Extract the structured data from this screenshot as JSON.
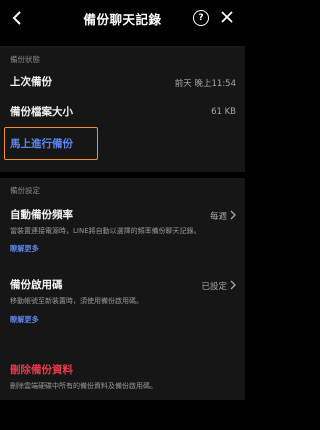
{
  "header": {
    "title": "備份聊天記錄",
    "help_glyph": "?"
  },
  "status_section": {
    "label": "備份狀態",
    "last_backup": {
      "label": "上次備份",
      "value": "前天 晚上11:54"
    },
    "file_size": {
      "label": "備份檔案大小",
      "value": "61 KB"
    },
    "backup_now": "馬上進行備份"
  },
  "settings_section": {
    "label": "備份設定",
    "auto_freq": {
      "label": "自動備份頻率",
      "value": "每週",
      "desc": "當裝置連接電源時，LINE將自動以選擇的頻率備份聊天記錄。",
      "link": "瞭解更多"
    },
    "pin": {
      "label": "備份啟用碼",
      "value": "已設定",
      "desc": "移動帳號至新裝置時，須使用備份啟用碼。",
      "link": "瞭解更多"
    },
    "delete": {
      "label": "刪除備份資料",
      "desc": "刪除雲端硬碟中所有的備份資料及備份啟用碼。"
    }
  },
  "colors": {
    "background": "#000000",
    "panel": "#161616",
    "link_blue": "#5b86ee",
    "delete_red": "#e8394a",
    "highlight_orange": "#f0922a"
  },
  "icons": [
    "back-chevron-icon",
    "help-icon",
    "close-icon",
    "chevron-right-icon"
  ]
}
